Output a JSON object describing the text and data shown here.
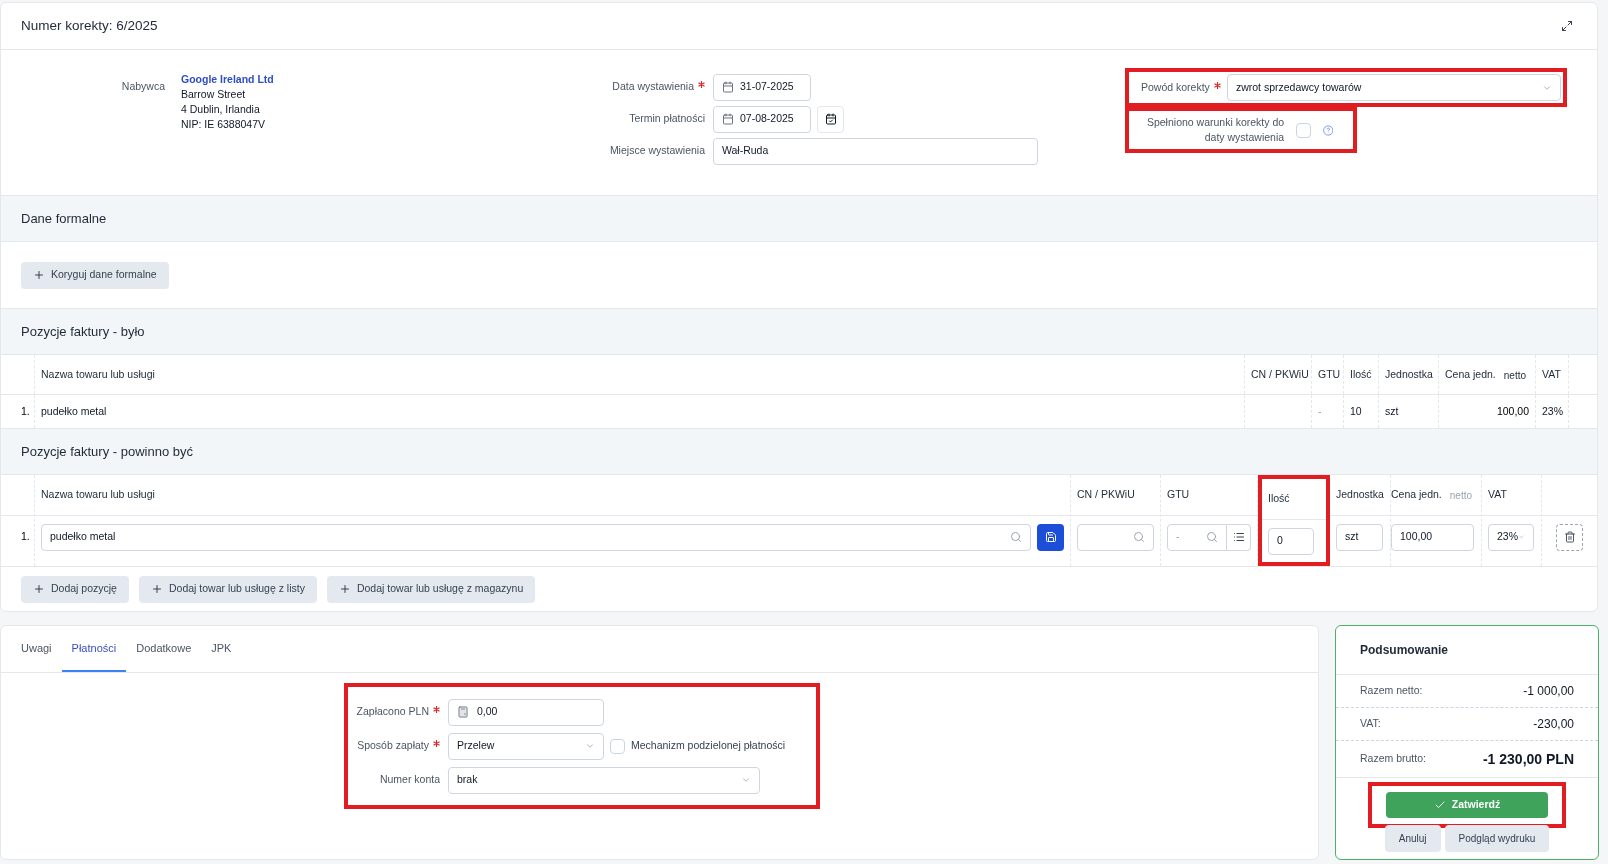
{
  "header": {
    "title": "Numer korekty: 6/2025"
  },
  "buyer": {
    "label": "Nabywca",
    "name": "Google Ireland Ltd",
    "lines": [
      "Barrow Street",
      "4 Dublin, Irlandia",
      "NIP: IE 6388047V"
    ]
  },
  "dates": [
    {
      "label": "Data wystawienia",
      "required": true,
      "value": "31-07-2025",
      "kind": "date"
    },
    {
      "label": "Termin płatności",
      "required": false,
      "value": "07-08-2025",
      "kind": "date-picker"
    },
    {
      "label": "Miejsce wystawienia",
      "required": false,
      "value": "Wał-Ruda",
      "kind": "text"
    }
  ],
  "reason": {
    "label": "Powód korekty",
    "required": true,
    "value": "zwrot sprzedawcy towarów",
    "highlight": true
  },
  "conditions": {
    "label": "Spełniono warunki korekty do daty wystawienia",
    "checked": false,
    "highlight": true
  },
  "formal": {
    "title": "Dane formalne",
    "button": "Koryguj dane formalne"
  },
  "was": {
    "title": "Pozycje faktury - było",
    "columns": [
      {
        "label": "Nazwa towaru lub usługi"
      },
      {
        "label": "CN / PKWiU"
      },
      {
        "label": "GTU"
      },
      {
        "label": "Ilość"
      },
      {
        "label": "Jednostka"
      },
      {
        "label": "Cena jedn.",
        "note": "netto"
      },
      {
        "label": "VAT"
      }
    ],
    "rows": [
      {
        "number": "1.",
        "cells": [
          "pudełko metal",
          null,
          "-",
          "10",
          "szt",
          "100,00",
          "23%"
        ]
      }
    ]
  },
  "should_be": {
    "title": "Pozycje faktury - powinno być",
    "columns": [
      {
        "label": "Nazwa towaru lub usługi",
        "highlight": false
      },
      {
        "label": "CN / PKWiU",
        "highlight": false
      },
      {
        "label": "GTU",
        "highlight": false
      },
      {
        "label": "Ilość",
        "highlight": true
      },
      {
        "label": "Jednostka",
        "highlight": false
      },
      {
        "label": "Cena jedn.",
        "note": "netto",
        "highlight": false
      },
      {
        "label": "VAT",
        "highlight": false
      }
    ],
    "rows": [
      {
        "number": "1.",
        "name": "pudełko metal",
        "gtu_placeholder": "-",
        "quantity": "0",
        "unit": "szt",
        "price": "100,00",
        "vat": "23%"
      }
    ],
    "buttons": [
      "Dodaj pozycję",
      "Dodaj towar lub usługę z listy",
      "Dodaj towar lub usługę z magazynu"
    ]
  },
  "tabs": [
    {
      "label": "Uwagi",
      "selected": false
    },
    {
      "label": "Płatności",
      "selected": true
    },
    {
      "label": "Dodatkowe",
      "selected": false
    },
    {
      "label": "JPK",
      "selected": false
    }
  ],
  "payment": {
    "highlight": true,
    "paid": {
      "label": "Zapłacono PLN",
      "required": true,
      "value": "0,00"
    },
    "method": {
      "label": "Sposób zapłaty",
      "required": true,
      "value": "Przelew"
    },
    "split": {
      "label": "Mechanizm podzielonej płatności",
      "checked": false
    },
    "account": {
      "label": "Numer konta",
      "value": "brak"
    }
  },
  "summary": {
    "title": "Podsumowanie",
    "rows": [
      {
        "label": "Razem netto:",
        "value": "-1 000,00",
        "kind": "normal"
      },
      {
        "label": "VAT:",
        "value": "-230,00",
        "kind": "normal"
      },
      {
        "label": "Razem brutto:",
        "value": "-1 230,00 PLN",
        "kind": "total"
      }
    ],
    "confirm": {
      "label": "Zatwierdź",
      "highlight": true
    },
    "buttons": [
      "Anuluj",
      "Podgląd wydruku"
    ]
  }
}
